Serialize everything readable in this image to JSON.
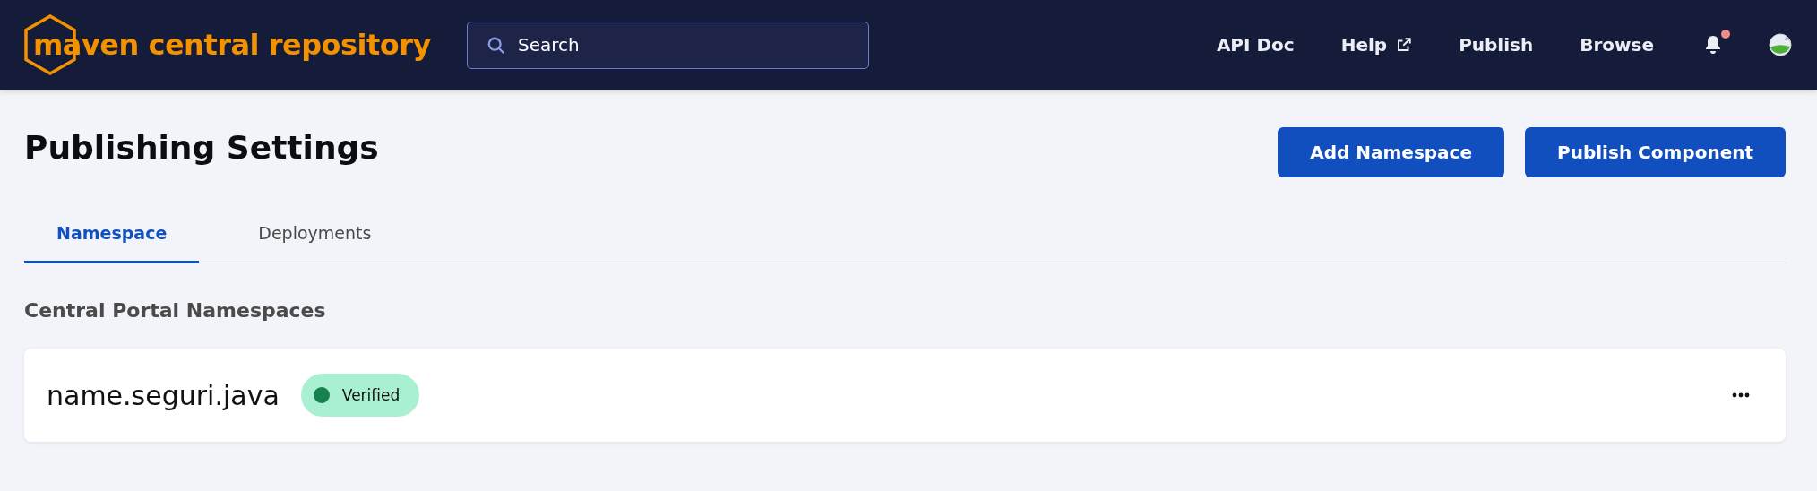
{
  "header": {
    "logo": "maven central repository",
    "search": {
      "placeholder": "Search"
    },
    "nav": [
      {
        "label": "API Doc",
        "external": false
      },
      {
        "label": "Help",
        "external": true
      },
      {
        "label": "Publish",
        "external": false
      },
      {
        "label": "Browse",
        "external": false
      }
    ],
    "notifications": {
      "unread": true
    }
  },
  "page": {
    "title": "Publishing Settings",
    "actions": [
      "Add Namespace",
      "Publish Component"
    ],
    "tabs": [
      {
        "label": "Namespace",
        "selected": true
      },
      {
        "label": "Deployments",
        "selected": false
      }
    ],
    "section_title": "Central Portal Namespaces",
    "namespaces": [
      {
        "name": "name.seguri.java",
        "status": "Verified",
        "color": "#16804f"
      }
    ]
  }
}
